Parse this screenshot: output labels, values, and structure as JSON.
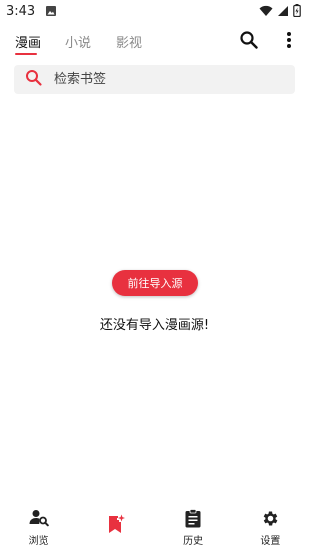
{
  "status_bar": {
    "time": "3:43",
    "icons": [
      "image-notification-icon",
      "wifi-icon",
      "signal-icon",
      "battery-icon"
    ]
  },
  "top_bar": {
    "tabs": [
      {
        "label": "漫画",
        "active": true
      },
      {
        "label": "小说",
        "active": false
      },
      {
        "label": "影视",
        "active": false
      }
    ],
    "actions": [
      "search-icon",
      "more-vert-icon"
    ],
    "accent_color": "#e8313f"
  },
  "search": {
    "placeholder": "检索书签",
    "value": ""
  },
  "empty_state": {
    "button_label": "前往导入源",
    "message": "还没有导入漫画源!"
  },
  "bottom_nav": {
    "items": [
      {
        "label": "浏览",
        "icon": "person-search-icon",
        "active": false
      },
      {
        "label": "",
        "icon": "bookmark-star-icon",
        "active": true
      },
      {
        "label": "历史",
        "icon": "clipboard-icon",
        "active": false
      },
      {
        "label": "设置",
        "icon": "gear-icon",
        "active": false
      }
    ]
  }
}
